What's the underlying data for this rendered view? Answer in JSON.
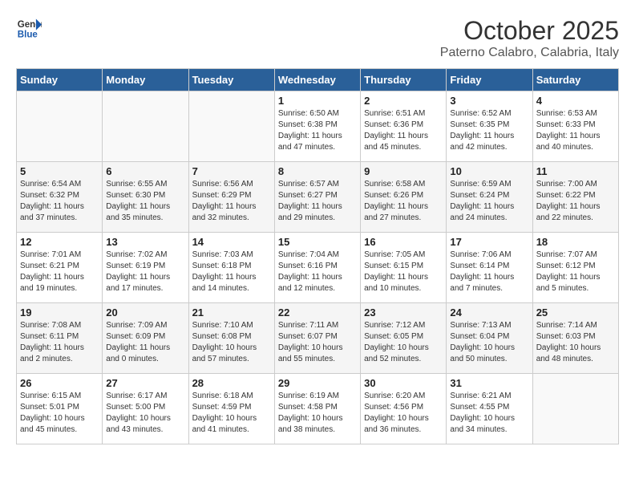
{
  "logo": {
    "line1": "General",
    "line2": "Blue"
  },
  "title": "October 2025",
  "subtitle": "Paterno Calabro, Calabria, Italy",
  "days_of_week": [
    "Sunday",
    "Monday",
    "Tuesday",
    "Wednesday",
    "Thursday",
    "Friday",
    "Saturday"
  ],
  "weeks": [
    [
      {
        "day": "",
        "info": ""
      },
      {
        "day": "",
        "info": ""
      },
      {
        "day": "",
        "info": ""
      },
      {
        "day": "1",
        "info": "Sunrise: 6:50 AM\nSunset: 6:38 PM\nDaylight: 11 hours\nand 47 minutes."
      },
      {
        "day": "2",
        "info": "Sunrise: 6:51 AM\nSunset: 6:36 PM\nDaylight: 11 hours\nand 45 minutes."
      },
      {
        "day": "3",
        "info": "Sunrise: 6:52 AM\nSunset: 6:35 PM\nDaylight: 11 hours\nand 42 minutes."
      },
      {
        "day": "4",
        "info": "Sunrise: 6:53 AM\nSunset: 6:33 PM\nDaylight: 11 hours\nand 40 minutes."
      }
    ],
    [
      {
        "day": "5",
        "info": "Sunrise: 6:54 AM\nSunset: 6:32 PM\nDaylight: 11 hours\nand 37 minutes."
      },
      {
        "day": "6",
        "info": "Sunrise: 6:55 AM\nSunset: 6:30 PM\nDaylight: 11 hours\nand 35 minutes."
      },
      {
        "day": "7",
        "info": "Sunrise: 6:56 AM\nSunset: 6:29 PM\nDaylight: 11 hours\nand 32 minutes."
      },
      {
        "day": "8",
        "info": "Sunrise: 6:57 AM\nSunset: 6:27 PM\nDaylight: 11 hours\nand 29 minutes."
      },
      {
        "day": "9",
        "info": "Sunrise: 6:58 AM\nSunset: 6:26 PM\nDaylight: 11 hours\nand 27 minutes."
      },
      {
        "day": "10",
        "info": "Sunrise: 6:59 AM\nSunset: 6:24 PM\nDaylight: 11 hours\nand 24 minutes."
      },
      {
        "day": "11",
        "info": "Sunrise: 7:00 AM\nSunset: 6:22 PM\nDaylight: 11 hours\nand 22 minutes."
      }
    ],
    [
      {
        "day": "12",
        "info": "Sunrise: 7:01 AM\nSunset: 6:21 PM\nDaylight: 11 hours\nand 19 minutes."
      },
      {
        "day": "13",
        "info": "Sunrise: 7:02 AM\nSunset: 6:19 PM\nDaylight: 11 hours\nand 17 minutes."
      },
      {
        "day": "14",
        "info": "Sunrise: 7:03 AM\nSunset: 6:18 PM\nDaylight: 11 hours\nand 14 minutes."
      },
      {
        "day": "15",
        "info": "Sunrise: 7:04 AM\nSunset: 6:16 PM\nDaylight: 11 hours\nand 12 minutes."
      },
      {
        "day": "16",
        "info": "Sunrise: 7:05 AM\nSunset: 6:15 PM\nDaylight: 11 hours\nand 10 minutes."
      },
      {
        "day": "17",
        "info": "Sunrise: 7:06 AM\nSunset: 6:14 PM\nDaylight: 11 hours\nand 7 minutes."
      },
      {
        "day": "18",
        "info": "Sunrise: 7:07 AM\nSunset: 6:12 PM\nDaylight: 11 hours\nand 5 minutes."
      }
    ],
    [
      {
        "day": "19",
        "info": "Sunrise: 7:08 AM\nSunset: 6:11 PM\nDaylight: 11 hours\nand 2 minutes."
      },
      {
        "day": "20",
        "info": "Sunrise: 7:09 AM\nSunset: 6:09 PM\nDaylight: 11 hours\nand 0 minutes."
      },
      {
        "day": "21",
        "info": "Sunrise: 7:10 AM\nSunset: 6:08 PM\nDaylight: 10 hours\nand 57 minutes."
      },
      {
        "day": "22",
        "info": "Sunrise: 7:11 AM\nSunset: 6:07 PM\nDaylight: 10 hours\nand 55 minutes."
      },
      {
        "day": "23",
        "info": "Sunrise: 7:12 AM\nSunset: 6:05 PM\nDaylight: 10 hours\nand 52 minutes."
      },
      {
        "day": "24",
        "info": "Sunrise: 7:13 AM\nSunset: 6:04 PM\nDaylight: 10 hours\nand 50 minutes."
      },
      {
        "day": "25",
        "info": "Sunrise: 7:14 AM\nSunset: 6:03 PM\nDaylight: 10 hours\nand 48 minutes."
      }
    ],
    [
      {
        "day": "26",
        "info": "Sunrise: 6:15 AM\nSunset: 5:01 PM\nDaylight: 10 hours\nand 45 minutes."
      },
      {
        "day": "27",
        "info": "Sunrise: 6:17 AM\nSunset: 5:00 PM\nDaylight: 10 hours\nand 43 minutes."
      },
      {
        "day": "28",
        "info": "Sunrise: 6:18 AM\nSunset: 4:59 PM\nDaylight: 10 hours\nand 41 minutes."
      },
      {
        "day": "29",
        "info": "Sunrise: 6:19 AM\nSunset: 4:58 PM\nDaylight: 10 hours\nand 38 minutes."
      },
      {
        "day": "30",
        "info": "Sunrise: 6:20 AM\nSunset: 4:56 PM\nDaylight: 10 hours\nand 36 minutes."
      },
      {
        "day": "31",
        "info": "Sunrise: 6:21 AM\nSunset: 4:55 PM\nDaylight: 10 hours\nand 34 minutes."
      },
      {
        "day": "",
        "info": ""
      }
    ]
  ]
}
